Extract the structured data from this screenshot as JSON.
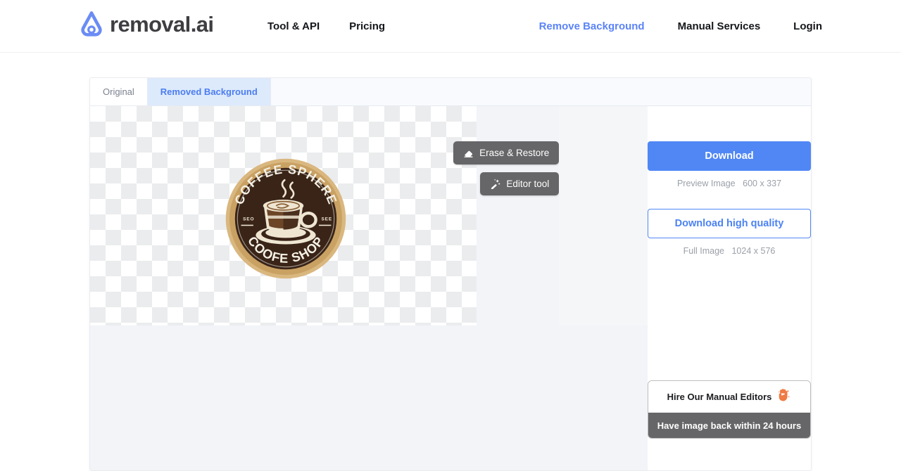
{
  "header": {
    "brand": {
      "logo_icon": "removal-ai-logo-icon",
      "text": "removal.ai"
    },
    "nav_left": [
      {
        "label": "Tool & API",
        "accent": false
      },
      {
        "label": "Pricing",
        "accent": false
      }
    ],
    "nav_right": [
      {
        "label": "Remove Background",
        "accent": true
      },
      {
        "label": "Manual Services",
        "accent": false
      },
      {
        "label": "Login",
        "accent": false
      }
    ]
  },
  "editor": {
    "tabs": [
      {
        "label": "Original",
        "active": false
      },
      {
        "label": "Removed Background",
        "active": true
      }
    ],
    "tools": [
      {
        "label": "Erase & Restore",
        "icon": "eraser-icon"
      },
      {
        "label": "Editor tool",
        "icon": "magic-wand-icon"
      }
    ],
    "artwork": {
      "name": "coffee-shop-logo",
      "top_arc_text": "COFFEE SPHERE",
      "bottom_arc_text": "COOFE SHOP",
      "left_text": "SEO",
      "right_text": "SEE",
      "ring_color": "#c9a163",
      "disc_color": "#3a2418"
    }
  },
  "panel": {
    "download_button": "Download",
    "preview_label": "Preview Image",
    "preview_dimensions": "600 x 337",
    "download_hq_button": "Download high quality",
    "full_label": "Full Image",
    "full_dimensions": "1024 x 576",
    "hire": {
      "title": "Hire Our Manual Editors",
      "icon": "raised-hand-sparkle-icon",
      "subtitle": "Have image back within 24 hours"
    }
  },
  "colors": {
    "accent_blue": "#5087f5",
    "tab_active_bg": "#ddeafc",
    "tool_gray": "#666668",
    "muted_text": "#9ba0a8"
  }
}
